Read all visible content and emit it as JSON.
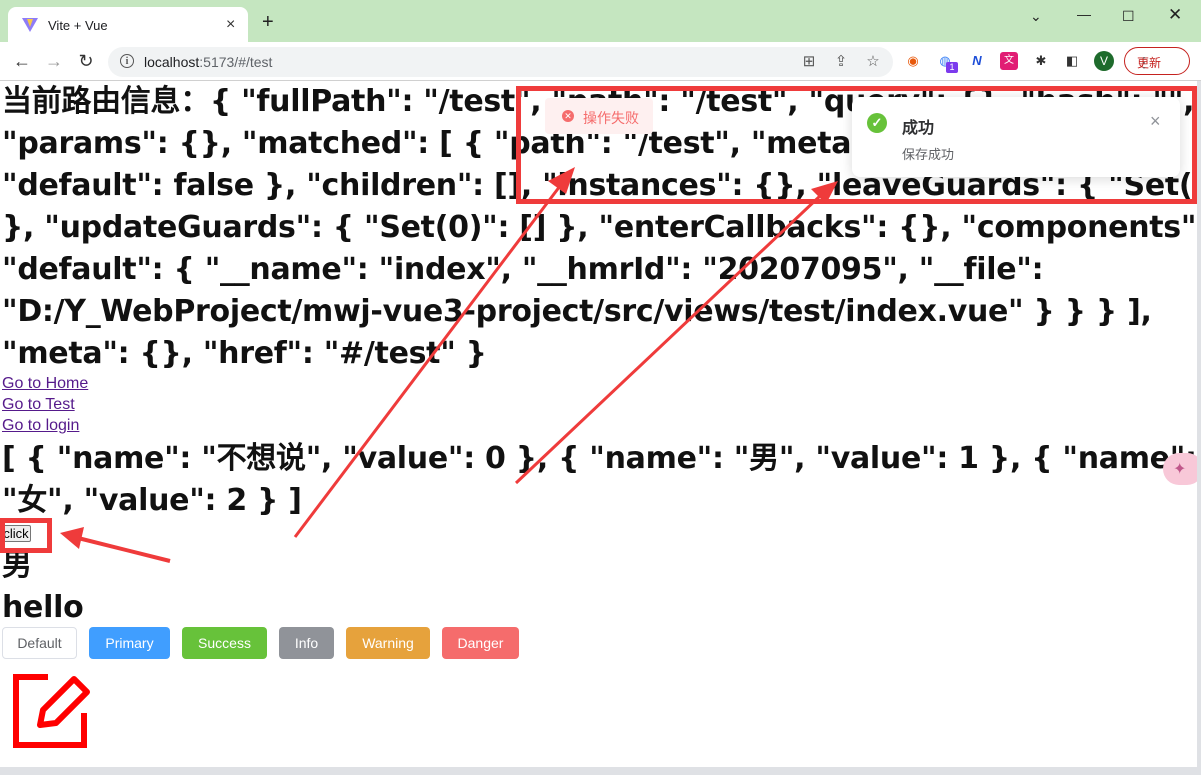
{
  "browser": {
    "tab_title": "Vite + Vue",
    "tab_close": "×",
    "new_tab": "+",
    "url_host": "localhost",
    "url_path": ":5173/#/test",
    "update_label": "更新",
    "avatar_letter": "V",
    "ext_badge": "1"
  },
  "page": {
    "route_lines": [
      "当前路由信息：{ \"fullPath\": \"/test\", \"path\": \"/test\", \"query\": {}, \"hash\": \"\",",
      "\"params\": {}, \"matched\": [ { \"path\": \"/test\", \"meta\": {}, \"props\": {",
      "\"default\": false }, \"children\": [], \"instances\": {}, \"leaveGuards\": { \"Set(0)\": []",
      "}, \"updateGuards\": { \"Set(0)\": [] }, \"enterCallbacks\": {}, \"components\": {",
      "\"default\": { \"__name\": \"index\", \"__hmrId\": \"20207095\", \"__file\":",
      "\"D:/Y_WebProject/mwj-vue3-project/src/views/test/index.vue\" } } } ],",
      "\"meta\": {}, \"href\": \"#/test\" }"
    ],
    "links": [
      "Go to Home",
      "Go to Test",
      "Go to login"
    ],
    "options_lines": [
      "[ { \"name\": \"不想说\", \"value\": 0 }, { \"name\": \"男\", \"value\": 1 }, { \"name\":",
      "\"女\", \"value\": 2 } ]"
    ],
    "click_label": "click",
    "gender_text": "男",
    "hello_text": "hello",
    "buttons": [
      {
        "label": "Default",
        "color": "#ffffff"
      },
      {
        "label": "Primary",
        "color": "#409eff"
      },
      {
        "label": "Success",
        "color": "#67c23a"
      },
      {
        "label": "Info",
        "color": "#909399"
      },
      {
        "label": "Warning",
        "color": "#e6a23c"
      },
      {
        "label": "Danger",
        "color": "#f56c6c"
      }
    ]
  },
  "message_error": {
    "text": "操作失败",
    "icon": "error-icon"
  },
  "notification": {
    "title": "成功",
    "body": "保存成功",
    "close": "×",
    "icon": "check-icon"
  },
  "colors": {
    "annotation_red": "#ef3b3b",
    "titlebar_green": "#c5e6c0"
  }
}
